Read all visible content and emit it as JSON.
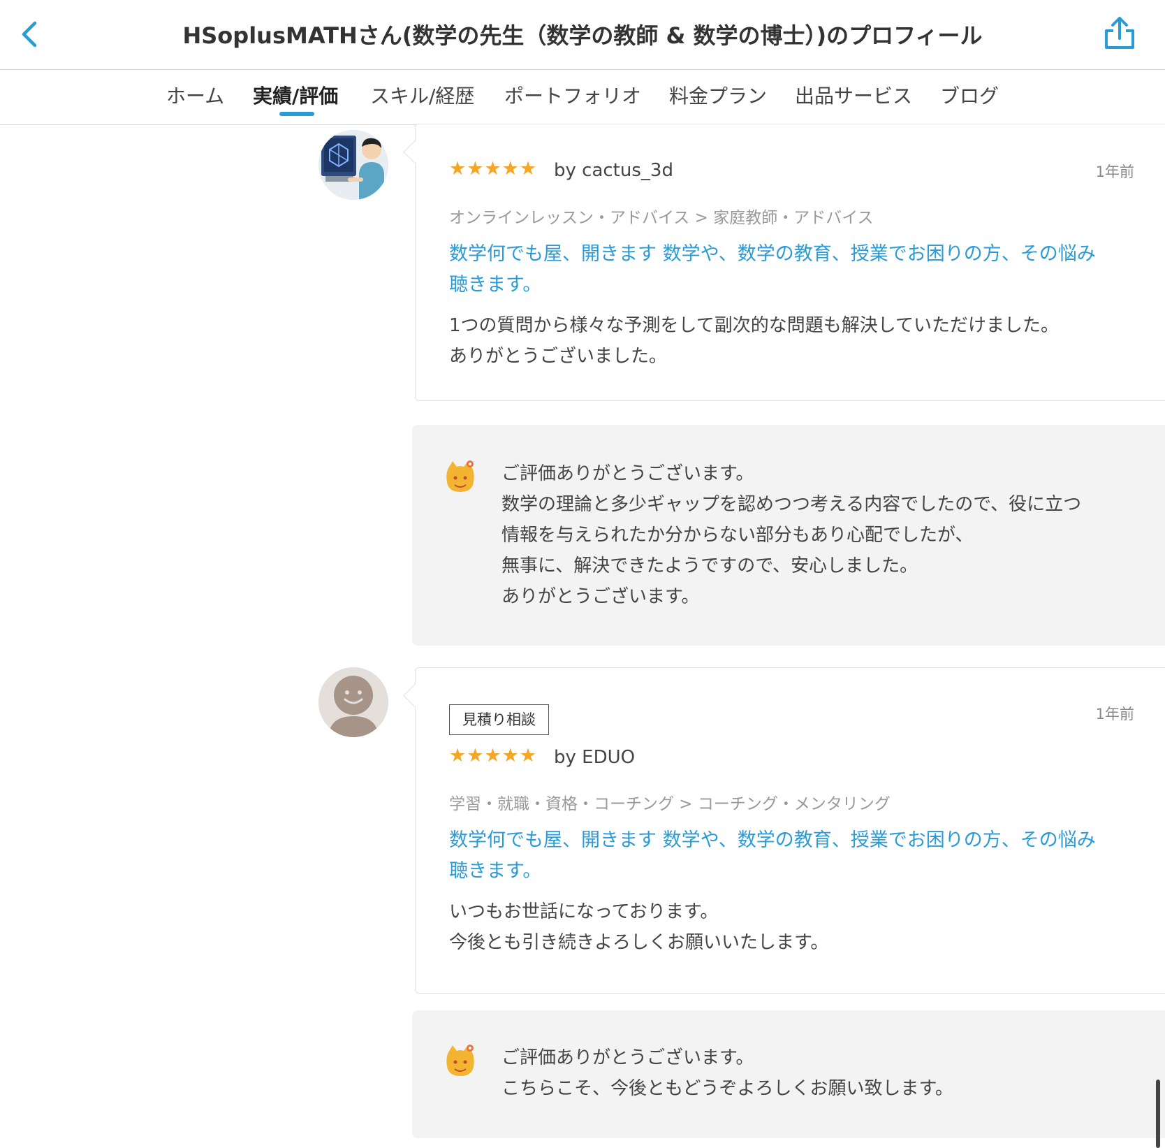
{
  "header": {
    "title": "HSoplusMATHさん(数学の先生（数学の教師 & 数学の博士）)のプロフィール",
    "back_icon": "chevron-left-icon",
    "share_icon": "share-icon",
    "accent_color": "#2b9bd6"
  },
  "tabs": [
    {
      "label": "ホーム",
      "active": false
    },
    {
      "label": "実績/評価",
      "active": true
    },
    {
      "label": "スキル/経歴",
      "active": false
    },
    {
      "label": "ポートフォリオ",
      "active": false
    },
    {
      "label": "料金プラン",
      "active": false
    },
    {
      "label": "出品サービス",
      "active": false
    },
    {
      "label": "ブログ",
      "active": false
    }
  ],
  "reviews": [
    {
      "badge": "",
      "rating": 5,
      "stars": "★★★★★",
      "byline": "by cactus_3d",
      "time": "1年前",
      "category": "オンラインレッスン・アドバイス > 家庭教師・アドバイス",
      "service_title": [
        "数学何でも屋、開きます 数学や、数学の教育、授業でお困りの方、その悩み",
        "聴きます。"
      ],
      "comment": [
        "1つの質問から様々な予測をして副次的な問題も解決していただけました。",
        "ありがとうございました。"
      ],
      "reply": [
        "ご評価ありがとうございます。",
        "数学の理論と多少ギャップを認めつつ考える内容でしたので、役に立つ",
        "情報を与えられたか分からない部分もあり心配でしたが、",
        "無事に、解決できたようですので、安心しました。",
        "ありがとうございます。"
      ]
    },
    {
      "badge": "見積り相談",
      "rating": 5,
      "stars": "★★★★★",
      "byline": "by EDUO",
      "time": "1年前",
      "category": "学習・就職・資格・コーチング > コーチング・メンタリング",
      "service_title": [
        "数学何でも屋、開きます 数学や、数学の教育、授業でお困りの方、その悩み",
        "聴きます。"
      ],
      "comment": [
        "いつもお世話になっております。",
        "今後とも引き続きよろしくお願いいたします。"
      ],
      "reply": [
        "ご評価ありがとうございます。",
        "こちらこそ、今後ともどうぞよろしくお願い致します。"
      ]
    }
  ]
}
